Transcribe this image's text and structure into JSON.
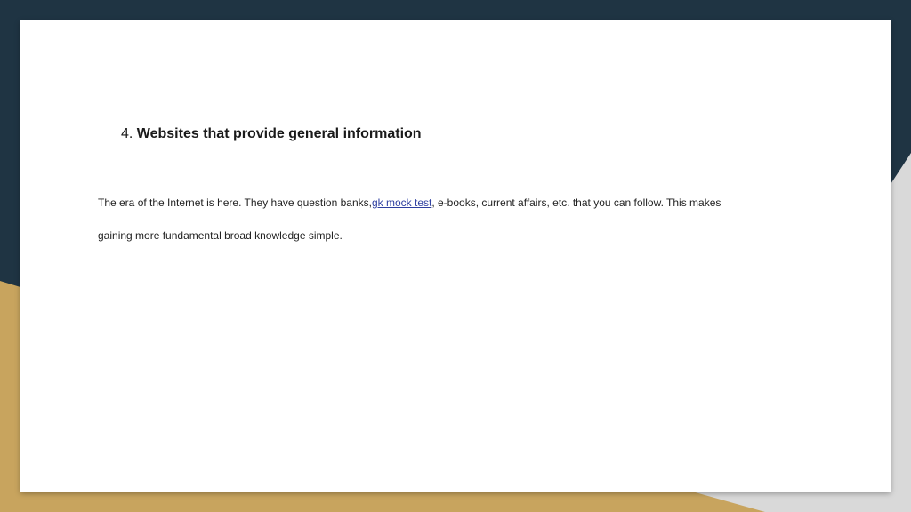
{
  "colors": {
    "navy": "#1f3443",
    "gold": "#c8a45e",
    "light_gray": "#d9d9d9",
    "link": "#2e3fa0"
  },
  "slide": {
    "heading_number": "4.",
    "heading_title": "Websites that provide general information",
    "paragraph": {
      "before_link": "The era of the Internet is here. They have question banks,",
      "link_text": "gk mock test",
      "after_link_line1": ", e-books, current affairs, etc. that you can follow. This makes",
      "line2": "gaining more fundamental broad knowledge simple."
    }
  }
}
